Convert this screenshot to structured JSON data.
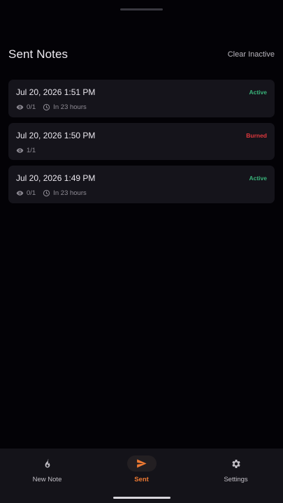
{
  "header": {
    "title": "Sent Notes",
    "clear_label": "Clear Inactive"
  },
  "notes": [
    {
      "date": "Jul 20, 2026 1:51 PM",
      "status": "Active",
      "status_color": "#39b37a",
      "views": "0/1",
      "expiry": "In 23 hours"
    },
    {
      "date": "Jul 20, 2026 1:50 PM",
      "status": "Burned",
      "status_color": "#e0383d",
      "views": "1/1",
      "expiry": ""
    },
    {
      "date": "Jul 20, 2026 1:49 PM",
      "status": "Active",
      "status_color": "#39b37a",
      "views": "0/1",
      "expiry": "In 23 hours"
    }
  ],
  "nav": {
    "items": [
      {
        "label": "New Note",
        "icon": "flame-icon"
      },
      {
        "label": "Sent",
        "icon": "send-icon",
        "active": true
      },
      {
        "label": "Settings",
        "icon": "gear-icon"
      }
    ]
  },
  "colors": {
    "accent": "#ee7a33",
    "active": "#39b37a",
    "burned": "#e0383d"
  }
}
